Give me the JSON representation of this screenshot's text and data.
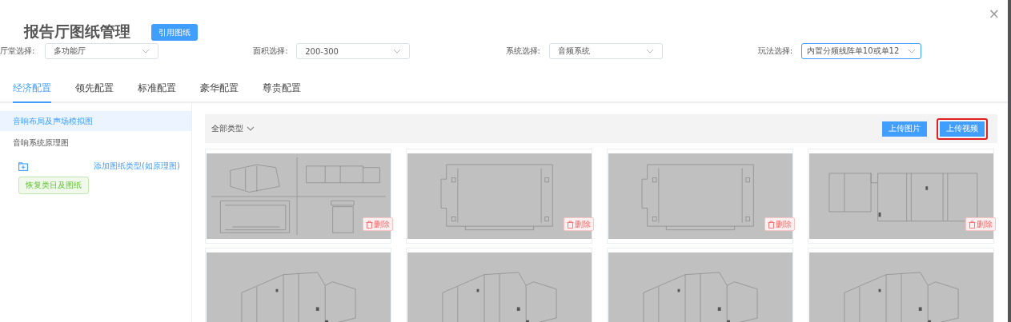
{
  "dialog": {
    "title": "报告厅图纸管理",
    "reference_button": "引用图纸",
    "close": "×"
  },
  "filters": [
    {
      "label": "厅堂选择:",
      "value": "多功能厅",
      "focused": false
    },
    {
      "label": "面积选择:",
      "value": "200-300",
      "focused": false
    },
    {
      "label": "系统选择:",
      "value": "音频系统",
      "focused": false
    },
    {
      "label": "玩法选择:",
      "value": "内置分频线阵单10或单12",
      "focused": true
    }
  ],
  "tabs": [
    {
      "label": "经济配置",
      "selected": true
    },
    {
      "label": "领先配置",
      "selected": false
    },
    {
      "label": "标准配置",
      "selected": false
    },
    {
      "label": "豪华配置",
      "selected": false
    },
    {
      "label": "尊贵配置",
      "selected": false
    }
  ],
  "sidebar": {
    "items": [
      {
        "label": "音响布局及声场模拟图",
        "selected": true
      },
      {
        "label": "音响系统原理图",
        "selected": false
      }
    ],
    "add_link": "添加图纸类型(如原理图)",
    "restore_button": "恢复类目及图纸"
  },
  "toolbar": {
    "type_filter": "全部类型",
    "buttons": [
      {
        "label": "上传图片",
        "highlighted": false
      },
      {
        "label": "上传视频",
        "highlighted": true
      }
    ]
  },
  "cards": [
    {
      "kind": "multiview",
      "delete_label": "删除"
    },
    {
      "kind": "plan",
      "delete_label": "删除"
    },
    {
      "kind": "plan",
      "delete_label": "删除"
    },
    {
      "kind": "elevation",
      "delete_label": "删除"
    },
    {
      "kind": "isometric"
    },
    {
      "kind": "isometric"
    },
    {
      "kind": "isometric"
    },
    {
      "kind": "isometric"
    }
  ]
}
